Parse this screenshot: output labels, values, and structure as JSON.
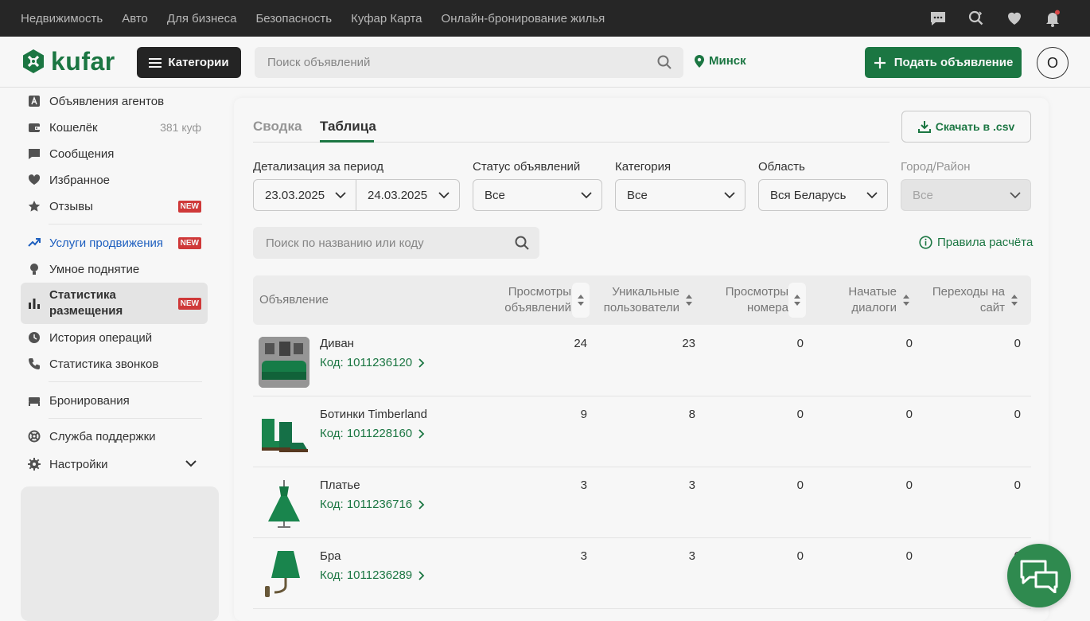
{
  "topbar": {
    "links": [
      "Недвижимость",
      "Авто",
      "Для бизнеса",
      "Безопасность",
      "Куфар Карта",
      "Онлайн-бронирование жилья"
    ],
    "icons": [
      "messages-icon",
      "saved-search-icon",
      "heart-icon",
      "bell-icon"
    ]
  },
  "header": {
    "logo_text": "kufar",
    "categories_label": "Категории",
    "search_placeholder": "Поиск объявлений",
    "city": "Минск",
    "post_label": "Подать объявление",
    "avatar_letter": "O"
  },
  "sidebar": {
    "items": [
      {
        "label": "Объявления агентов",
        "icon": "agent-icon"
      },
      {
        "label": "Кошелёк",
        "icon": "wallet-icon",
        "meta": "381 куф"
      },
      {
        "label": "Сообщения",
        "icon": "chat-icon"
      },
      {
        "label": "Избранное",
        "icon": "heart-icon"
      },
      {
        "label": "Отзывы",
        "icon": "star-icon",
        "badge": "NEW"
      },
      {
        "label": "Услуги продвижения",
        "icon": "trend-up-icon",
        "badge": "NEW"
      },
      {
        "label": "Умное поднятие",
        "icon": "bulb-icon"
      },
      {
        "label": "Статистика размещения",
        "icon": "bar-chart-icon",
        "badge": "NEW"
      },
      {
        "label": "История операций",
        "icon": "clock-icon"
      },
      {
        "label": "Статистика звонков",
        "icon": "phone-icon"
      },
      {
        "label": "Бронирования",
        "icon": "bed-icon"
      },
      {
        "label": "Служба поддержки",
        "icon": "lifebuoy-icon"
      },
      {
        "label": "Настройки",
        "icon": "gear-icon"
      }
    ]
  },
  "main": {
    "tabs": [
      {
        "label": "Сводка",
        "active": false
      },
      {
        "label": "Таблица",
        "active": true
      }
    ],
    "csv_label": "Скачать в .csv",
    "filters": {
      "period_label": "Детализация за период",
      "date_from": "23.03.2025",
      "date_to": "24.03.2025",
      "status_label": "Статус объявлений",
      "status_value": "Все",
      "category_label": "Категория",
      "category_value": "Все",
      "region_label": "Область",
      "region_value": "Вся Беларусь",
      "city_label": "Город/Район",
      "city_value": "Все"
    },
    "table_search_placeholder": "Поиск по названию или коду",
    "rules_label": "Правила расчёта",
    "columns": {
      "ad": "Объявление",
      "views_1": "Просмотры",
      "views_2": "объявлений",
      "users_1": "Уникальные",
      "users_2": "пользователи",
      "phone_1": "Просмотры",
      "phone_2": "номера",
      "dialogs_1": "Начатые",
      "dialogs_2": "диалоги",
      "site_1": "Переходы на",
      "site_2": "сайт"
    },
    "rows": [
      {
        "name": "Диван",
        "code": "Код: 1011236120",
        "views": "24",
        "users": "23",
        "phone": "0",
        "dialogs": "0",
        "site": "0"
      },
      {
        "name": "Ботинки Timberland",
        "code": "Код: 1011228160",
        "views": "9",
        "users": "8",
        "phone": "0",
        "dialogs": "0",
        "site": "0"
      },
      {
        "name": "Платье",
        "code": "Код: 1011236716",
        "views": "3",
        "users": "3",
        "phone": "0",
        "dialogs": "0",
        "site": "0"
      },
      {
        "name": "Бра",
        "code": "Код: 1011236289",
        "views": "3",
        "users": "3",
        "phone": "0",
        "dialogs": "0",
        "site": "0"
      }
    ]
  },
  "colors": {
    "brand": "#1c7a45",
    "badge": "#d63b3b",
    "topbar": "#282828"
  }
}
